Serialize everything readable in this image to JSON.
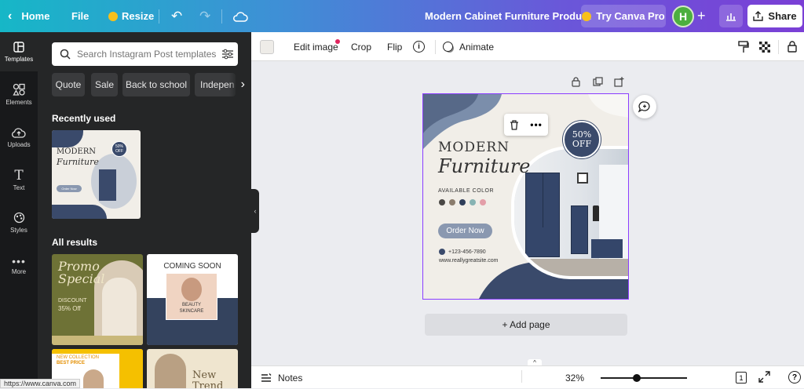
{
  "topbar": {
    "home_label": "Home",
    "file_label": "File",
    "resize_label": "Resize",
    "doc_title": "Modern Cabinet Furniture Product",
    "try_pro_label": "Try Canva Pro",
    "avatar_initial": "H",
    "share_label": "Share"
  },
  "rail": [
    {
      "label": "Templates",
      "icon": "templates-icon"
    },
    {
      "label": "Elements",
      "icon": "elements-icon"
    },
    {
      "label": "Uploads",
      "icon": "uploads-icon"
    },
    {
      "label": "Text",
      "icon": "text-icon"
    },
    {
      "label": "Styles",
      "icon": "styles-icon"
    },
    {
      "label": "More",
      "icon": "more-icon"
    }
  ],
  "panel": {
    "search_placeholder": "Search Instagram Post templates",
    "chips": [
      "Quote",
      "Sale",
      "Back to school",
      "Indepen"
    ],
    "recently_used_title": "Recently used",
    "all_results_title": "All results",
    "recent_thumb": {
      "title1": "MODERN",
      "title2": "Furniture",
      "badge": "50% OFF",
      "button": "Order Now"
    },
    "results": [
      {
        "line1": "Promo",
        "line2": "Special",
        "line3": "DISCOUNT",
        "line4": "35% Off"
      },
      {
        "line1": "COMING SOON",
        "line2": "BEAUTY",
        "line3": "SKINCARE"
      },
      {
        "line1": "NEW COLLECTION",
        "line2": "BEST PRICE"
      },
      {
        "line1": "New",
        "line2": "Trend"
      }
    ]
  },
  "toolbar": {
    "edit_image_label": "Edit image",
    "crop_label": "Crop",
    "flip_label": "Flip",
    "animate_label": "Animate"
  },
  "design": {
    "title_line1": "MODERN",
    "title_line2": "Furniture",
    "badge_line1": "50%",
    "badge_line2": "OFF",
    "available_label": "AVAILABLE COLOR",
    "swatches": [
      "#4a4845",
      "#8a7c6d",
      "#2f3e5a",
      "#87b3b3",
      "#e39ea8"
    ],
    "order_button": "Order Now",
    "phone": "+123-456-7890",
    "website": "www.reallygreatsite.com"
  },
  "canvas": {
    "add_page_label": "+ Add page"
  },
  "bottombar": {
    "notes_label": "Notes",
    "zoom_label": "32%",
    "zoom_level": 0.32,
    "page_count": "1"
  },
  "statusbar": {
    "url": "https://www.canva.com"
  },
  "colors": {
    "accent": "#8b3dff",
    "navy": "#3a4a6b",
    "rail_bg": "#18191b",
    "panel_bg": "#252627"
  }
}
